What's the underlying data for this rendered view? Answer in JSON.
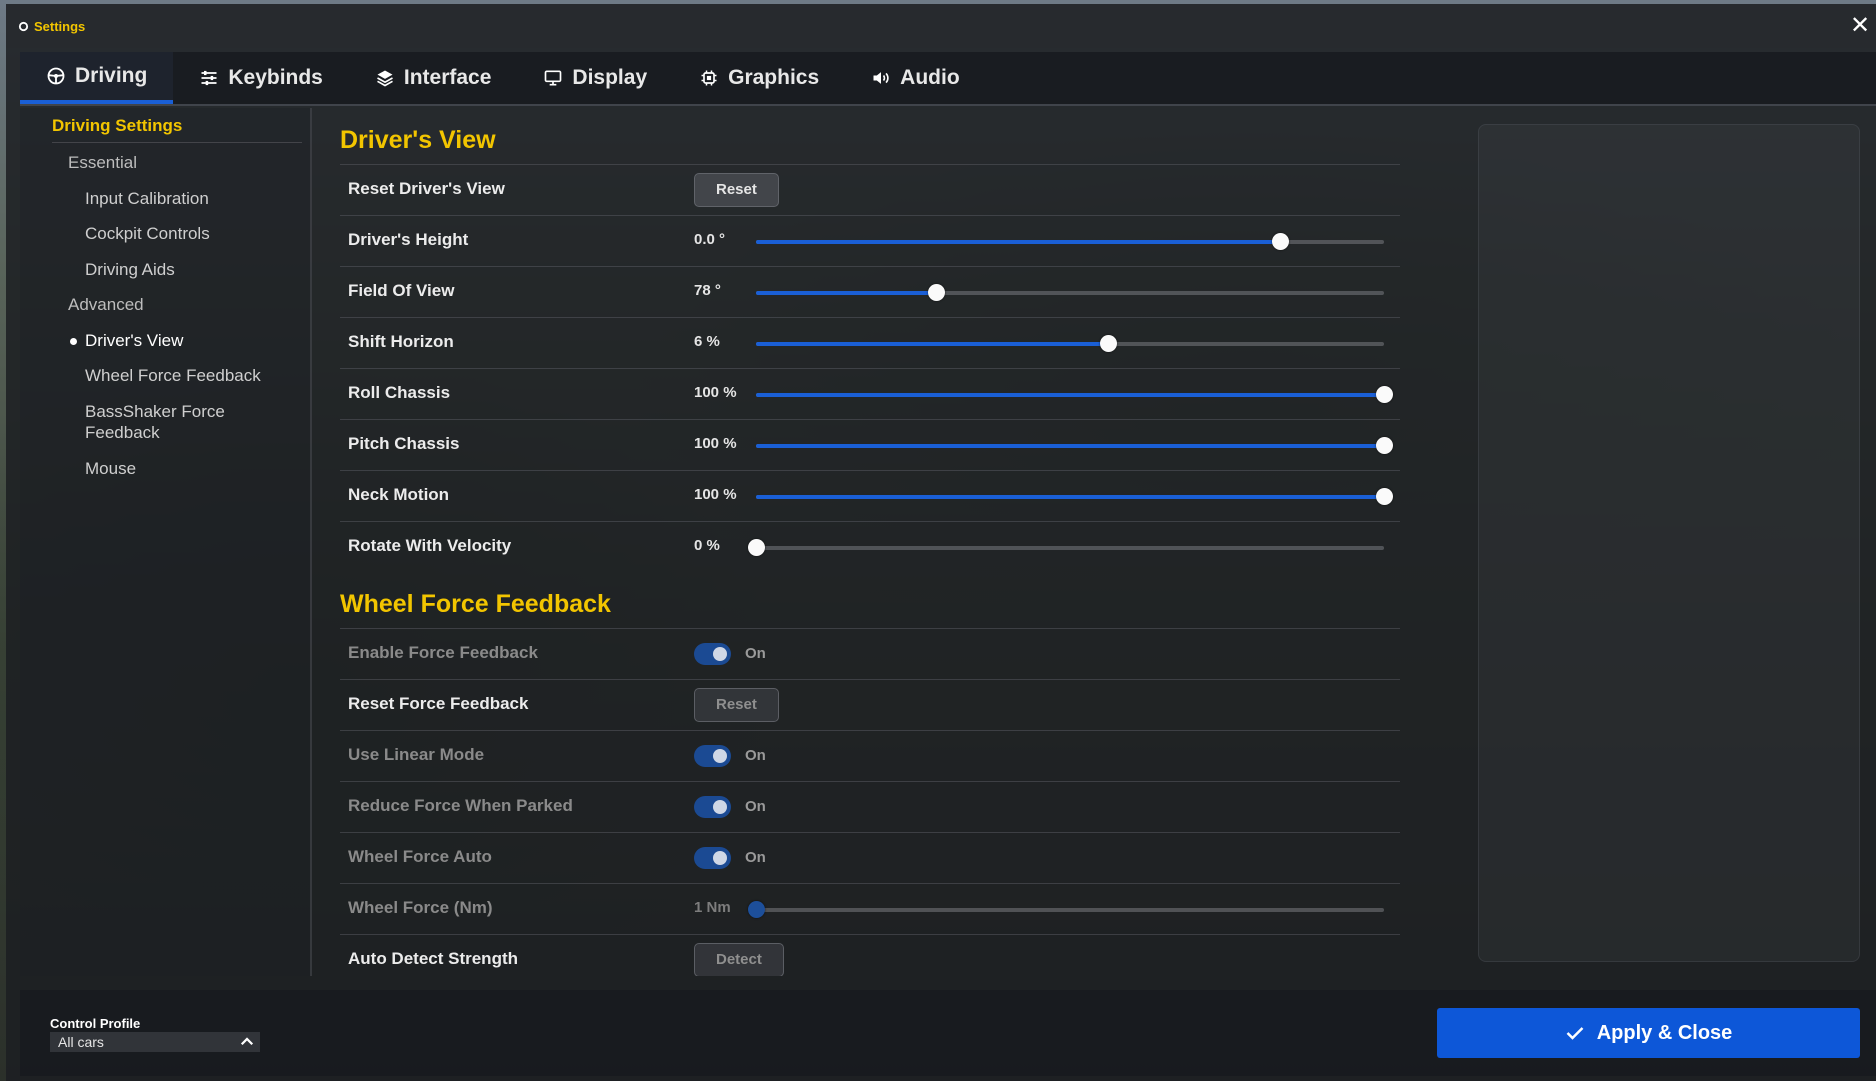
{
  "window": {
    "title": "Settings",
    "close_glyph": "✕"
  },
  "tabs": [
    {
      "label": "Driving",
      "icon": "steering-wheel-icon",
      "active": true
    },
    {
      "label": "Keybinds",
      "icon": "sliders-icon"
    },
    {
      "label": "Interface",
      "icon": "layers-icon"
    },
    {
      "label": "Display",
      "icon": "monitor-icon"
    },
    {
      "label": "Graphics",
      "icon": "chip-icon"
    },
    {
      "label": "Audio",
      "icon": "speaker-icon"
    }
  ],
  "sidebar": {
    "heading": "Driving Settings",
    "items": [
      {
        "label": "Essential",
        "type": "section"
      },
      {
        "label": "Input Calibration"
      },
      {
        "label": "Cockpit Controls"
      },
      {
        "label": "Driving Aids"
      },
      {
        "label": "Advanced",
        "type": "section"
      },
      {
        "label": "Driver's View",
        "active": true
      },
      {
        "label": "Wheel Force Feedback"
      },
      {
        "label": "BassShaker Force\nFeedback"
      },
      {
        "label": "Mouse"
      }
    ]
  },
  "drivers_view": {
    "title": "Driver's View",
    "rows": [
      {
        "label": "Reset Driver's View",
        "control": "button",
        "button_label": "Reset"
      },
      {
        "label": "Driver's Height",
        "control": "slider",
        "value_text": "0.0 °",
        "level": 0.834
      },
      {
        "label": "Field Of View",
        "control": "slider",
        "value_text": "78 °",
        "level": 0.287
      },
      {
        "label": "Shift Horizon",
        "control": "slider",
        "value_text": "6 %",
        "level": 0.56
      },
      {
        "label": "Roll Chassis",
        "control": "slider",
        "value_text": "100 %",
        "level": 1.0
      },
      {
        "label": "Pitch Chassis",
        "control": "slider",
        "value_text": "100 %",
        "level": 1.0
      },
      {
        "label": "Neck Motion",
        "control": "slider",
        "value_text": "100 %",
        "level": 1.0
      },
      {
        "label": "Rotate With Velocity",
        "control": "slider",
        "value_text": "0 %",
        "level": 0.0
      }
    ]
  },
  "wheel_force_feedback": {
    "title": "Wheel Force Feedback",
    "rows": [
      {
        "label": "Enable Force Feedback",
        "control": "toggle",
        "state_text": "On",
        "disabled": true
      },
      {
        "label": "Reset Force Feedback",
        "control": "button",
        "button_label": "Reset",
        "dim": true
      },
      {
        "label": "Use Linear Mode",
        "control": "toggle",
        "state_text": "On",
        "disabled": true
      },
      {
        "label": "Reduce Force When Parked",
        "control": "toggle",
        "state_text": "On",
        "disabled": true
      },
      {
        "label": "Wheel Force Auto",
        "control": "toggle",
        "state_text": "On",
        "disabled": true
      },
      {
        "label": "Wheel Force (Nm)",
        "control": "slider",
        "value_text": "1 Nm",
        "level": 0.0,
        "disabled": true
      },
      {
        "label": "Auto Detect Strength",
        "control": "button",
        "button_label": "Detect",
        "dim": true
      }
    ]
  },
  "footer": {
    "profile_label": "Control Profile",
    "profile_value": "All cars",
    "apply_label": "Apply & Close"
  },
  "colors": {
    "accent": "#f2c500",
    "primary": "#0d57d8",
    "slider_fill": "#1a5fd6"
  }
}
